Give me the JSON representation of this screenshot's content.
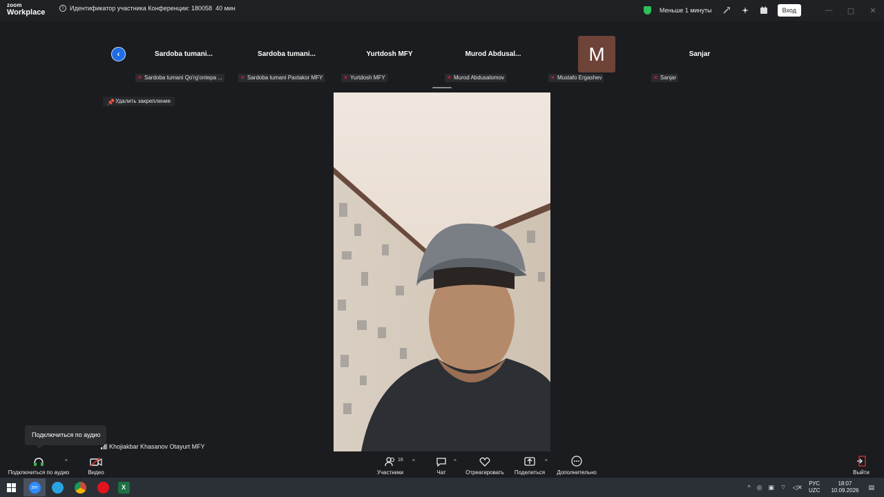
{
  "titlebar": {
    "brand_small": "zoom",
    "brand_large": "Workplace",
    "meeting_id_text": "Идентификатор участника Конференции: 180058",
    "duration": "40 мин",
    "timer_text": "Меньше 1 минуты",
    "signin_label": "Вход"
  },
  "strip": {
    "tiles": [
      {
        "name": "Sardoba  tumani...",
        "label": "Sardoba tumani Qo'rg'ontepa ..."
      },
      {
        "name": "Sardoba  tumani...",
        "label": "Sardoba tumani Paxtakor MFY"
      },
      {
        "name": "Yurtdosh MFY",
        "label": "Yurtdosh MFY"
      },
      {
        "name": "Murod  Abdusal...",
        "label": "Murod Abdusalomov"
      },
      {
        "avatar": "M",
        "label": "Mustafo Ergashev"
      },
      {
        "name": "Sanjar",
        "label": "Sanjar"
      }
    ]
  },
  "unpin_label": "Удалить закрепление",
  "tooltip": "Подключиться по аудио",
  "active_speaker": "Khojiakbar Khasanov Otayurt MFY",
  "toolbar": {
    "audio": "Подключиться по аудио",
    "video": "Видео",
    "participants": "Участники",
    "participants_count": "16",
    "chat": "Чат",
    "react": "Отреагировать",
    "share": "Поделиться",
    "more": "Дополнительно",
    "leave": "Выйти"
  },
  "taskbar": {
    "lang_top": "РУС",
    "lang_bottom": "UZC",
    "time": "18:07",
    "date": "10.09.2026"
  }
}
